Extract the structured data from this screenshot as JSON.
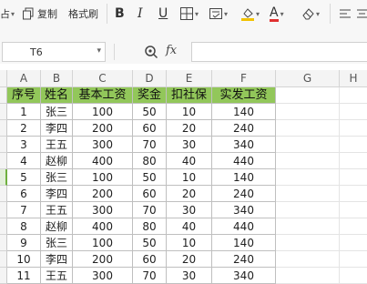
{
  "toolbar": {
    "paste_partial": "占",
    "copy_label": "复制",
    "format_painter_label": "格式刷",
    "bold": "B",
    "italic": "I",
    "underline": "U",
    "font_color_glyph": "A",
    "accent_font_color": "#e03030",
    "accent_fill_color": "#f2c200"
  },
  "formula_bar": {
    "name_box": "T6",
    "fx_label": "fx",
    "formula": ""
  },
  "sheet": {
    "columns": [
      "A",
      "B",
      "C",
      "D",
      "E",
      "F",
      "G",
      "H"
    ],
    "header_fill": "#92c75a",
    "headers": [
      "序号",
      "姓名",
      "基本工资",
      "奖金",
      "扣社保",
      "实发工资"
    ],
    "rows": [
      [
        "1",
        "张三",
        "100",
        "50",
        "10",
        "140"
      ],
      [
        "2",
        "李四",
        "200",
        "60",
        "20",
        "240"
      ],
      [
        "3",
        "王五",
        "300",
        "70",
        "30",
        "340"
      ],
      [
        "4",
        "赵柳",
        "400",
        "80",
        "40",
        "440"
      ],
      [
        "5",
        "张三",
        "100",
        "50",
        "10",
        "140"
      ],
      [
        "6",
        "李四",
        "200",
        "60",
        "20",
        "240"
      ],
      [
        "7",
        "王五",
        "300",
        "70",
        "30",
        "340"
      ],
      [
        "8",
        "赵柳",
        "400",
        "80",
        "40",
        "440"
      ],
      [
        "9",
        "张三",
        "100",
        "50",
        "10",
        "140"
      ],
      [
        "10",
        "李四",
        "200",
        "60",
        "20",
        "240"
      ],
      [
        "11",
        "王五",
        "300",
        "70",
        "30",
        "340"
      ]
    ]
  }
}
